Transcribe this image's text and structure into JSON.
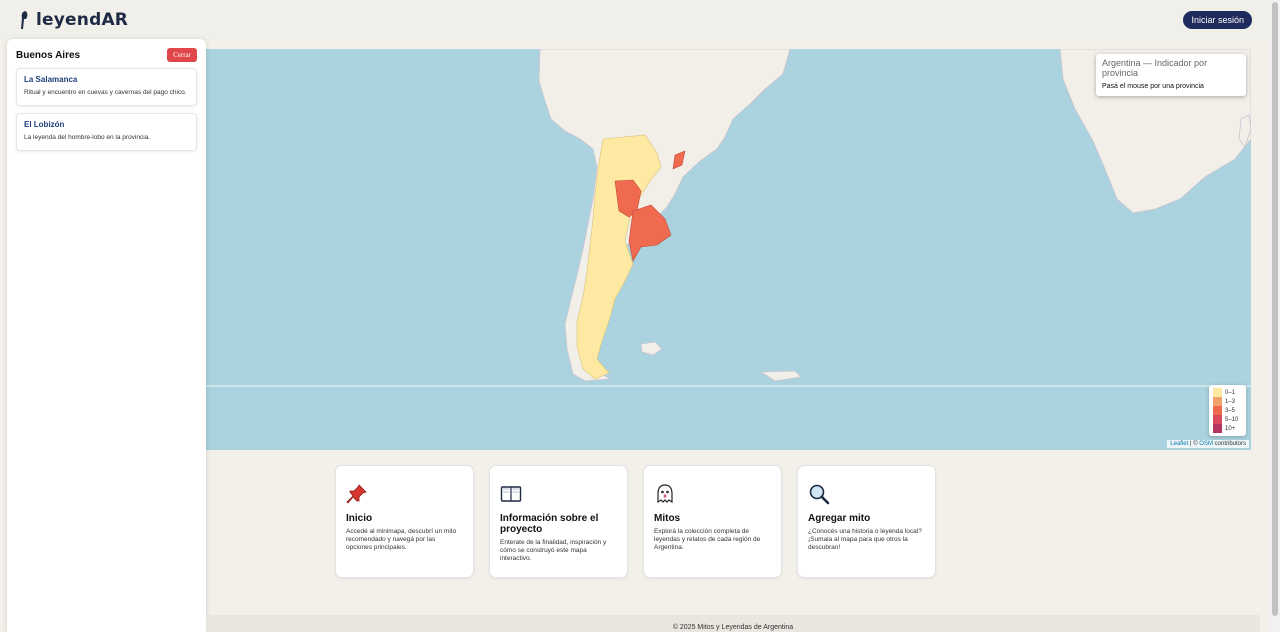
{
  "header": {
    "brand": "leyendAR",
    "login_label": "Iniciar sesión"
  },
  "side_panel": {
    "title": "Buenos Aires",
    "close_label": "Cerrar",
    "myths": [
      {
        "title": "La Salamanca",
        "description": "Ritual y encuentro en cuevas y cavernas del pago chico."
      },
      {
        "title": "El Lobizón",
        "description": "La leyenda del hombre-lobo en la provincia."
      }
    ]
  },
  "map": {
    "info_title": "Argentina — Indicador por provincia",
    "info_hint": "Pasá el mouse por una provincia",
    "legend": [
      {
        "label": "0–1",
        "color": "#fde9a1"
      },
      {
        "label": "1–3",
        "color": "#f4a26c"
      },
      {
        "label": "3–5",
        "color": "#ef6a4f"
      },
      {
        "label": "5–10",
        "color": "#d84a5c"
      },
      {
        "label": "10+",
        "color": "#b3355e"
      }
    ],
    "attribution_leaflet": "Leaflet",
    "attribution_sep": "| ©",
    "attribution_osm": "OSM",
    "attribution_rest": "contributors",
    "ocean_color": "#aad3df",
    "land_color": "#f2efe9"
  },
  "cards": [
    {
      "title": "Inicio",
      "text": "Accedé al minimapa, descubrí un mito recomendado y navegá por las opciones principales.",
      "icon": "pushpin-icon"
    },
    {
      "title": "Información sobre el proyecto",
      "text": "Enterate de la finalidad, inspiración y cómo se construyó este mapa interactivo.",
      "icon": "book-icon"
    },
    {
      "title": "Mitos",
      "text": "Explorá la colección completa de leyendas y relatos de cada región de Argentina.",
      "icon": "ghost-icon"
    },
    {
      "title": "Agregar mito",
      "text": "¿Conocés una historia o leyenda local? ¡Sumala al mapa para que otros la descubran!",
      "icon": "magnifier-icon"
    }
  ],
  "footer": {
    "text": "© 2025 Mitos y Leyendas de Argentina"
  }
}
